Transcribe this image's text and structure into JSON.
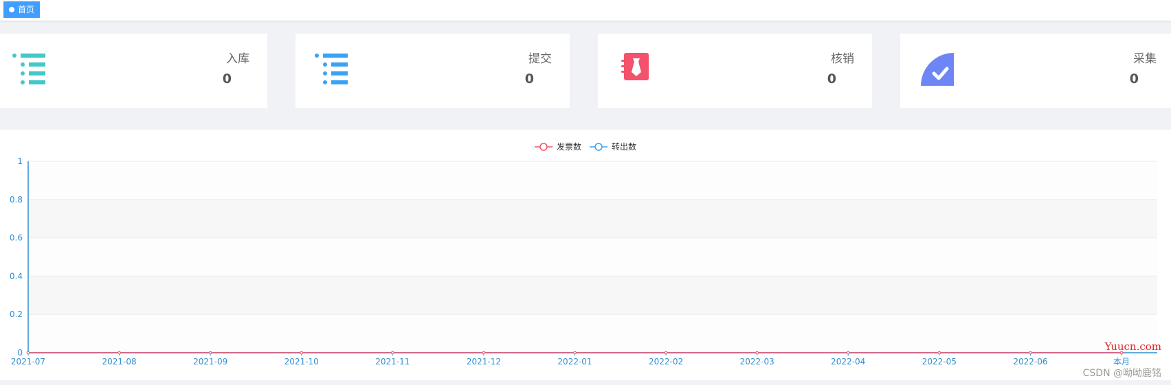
{
  "tab": {
    "label": "首页",
    "active_color": "#409eff"
  },
  "cards": [
    {
      "label": "入库",
      "value": "0",
      "icon": "list-icon",
      "color": "#40c9c6"
    },
    {
      "label": "提交",
      "value": "0",
      "icon": "list-icon",
      "color": "#36a3f7"
    },
    {
      "label": "核销",
      "value": "0",
      "icon": "notebook-icon",
      "color": "#f4516c"
    },
    {
      "label": "采集",
      "value": "0",
      "icon": "check-quarter-icon",
      "color": "#6e86f5"
    }
  ],
  "chart_data": {
    "type": "line",
    "categories": [
      "2021-07",
      "2021-08",
      "2021-09",
      "2021-10",
      "2021-11",
      "2021-12",
      "2022-01",
      "2022-02",
      "2022-03",
      "2022-04",
      "2022-05",
      "2022-06",
      "本月"
    ],
    "series": [
      {
        "name": "发票数",
        "color": "#f4516c",
        "values": [
          0,
          0,
          0,
          0,
          0,
          0,
          0,
          0,
          0,
          0,
          0,
          0,
          0
        ]
      },
      {
        "name": "转出数",
        "color": "#36a3f7",
        "values": [
          0,
          0,
          0,
          0,
          0,
          0,
          0,
          0,
          0,
          0,
          0,
          0,
          0
        ]
      }
    ],
    "yticks": [
      "0",
      "0.2",
      "0.4",
      "0.6",
      "0.8",
      "1"
    ],
    "ylim": [
      0,
      1
    ],
    "legend_position": "top-center",
    "axis_color": "#2f8fd1"
  },
  "watermarks": {
    "site": "Yuucn.com",
    "csdn": "CSDN @呦呦鹿铭"
  }
}
